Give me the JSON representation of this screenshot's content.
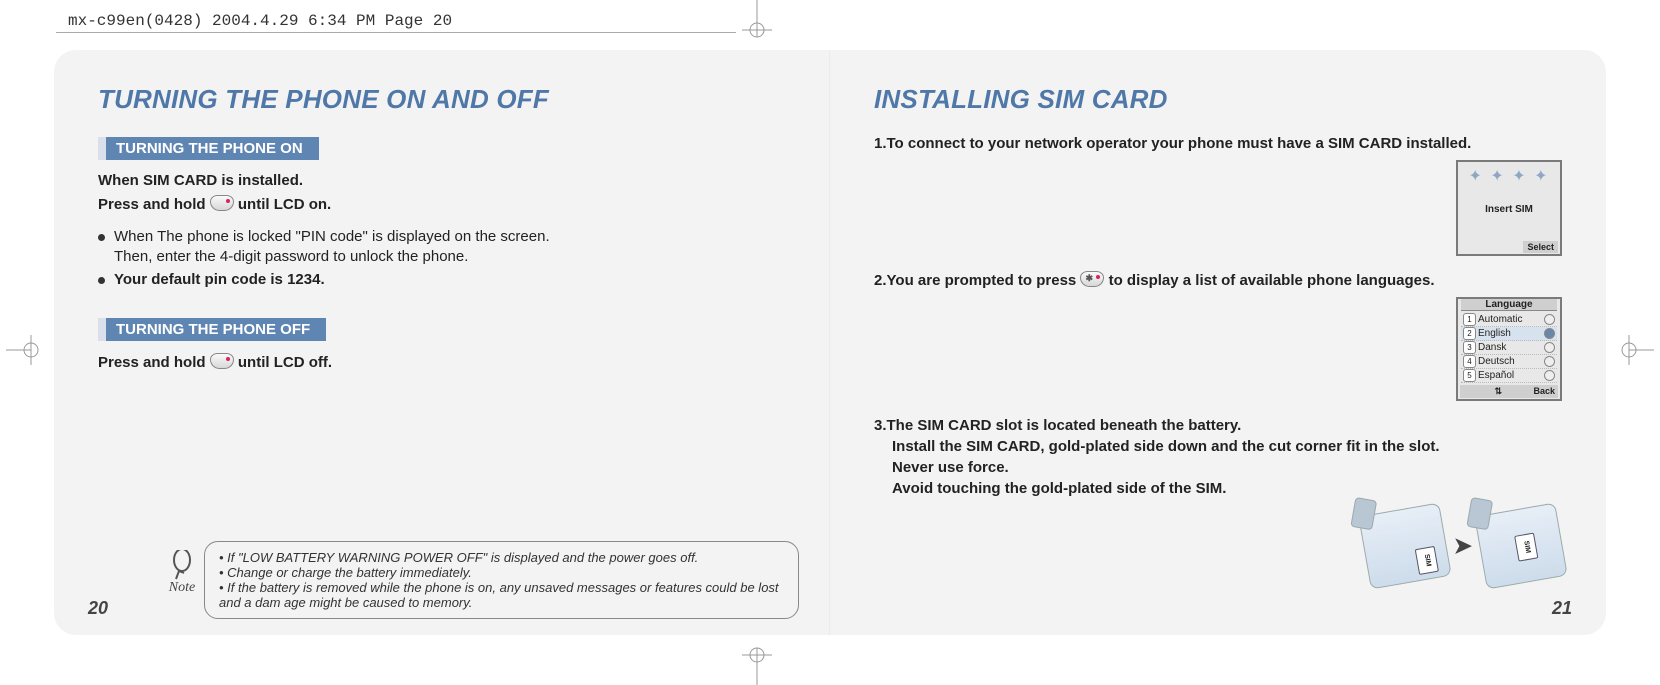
{
  "header_line": "mx-c99en(0428)  2004.4.29  6:34 PM  Page 20",
  "left": {
    "title": "TURNING THE PHONE ON AND OFF",
    "section_on": "TURNING THE PHONE ON",
    "on_line1": "When SIM CARD is installed.",
    "on_line2a": "Press and hold ",
    "on_line2b": " until LCD on.",
    "bullet1a": "When The phone is locked \"PIN code\" is displayed on the screen.",
    "bullet1b": "Then, enter the 4-digit password to unlock the phone.",
    "bullet2": "Your default pin code is 1234.",
    "section_off": "TURNING THE PHONE OFF",
    "off_line1a": "Press and hold ",
    "off_line1b": " until LCD off.",
    "note_label": "Note",
    "note1": "If \"LOW BATTERY WARNING POWER OFF\" is displayed and the power goes off.",
    "note2": "Change or charge the battery immediately.",
    "note3": "If the battery is removed while the phone is on, any unsaved messages or features could be lost and a dam age might be caused to memory.",
    "page_num": "20"
  },
  "right": {
    "title": "INSTALLING SIM CARD",
    "step1": "1.To connect to your network operator your phone must have a SIM CARD installed.",
    "screen1_msg": "Insert SIM",
    "screen1_soft": "Select",
    "step2a": "2.You are prompted to press ",
    "step2b": " to display a list of available phone languages.",
    "screen2_title": "Language",
    "screen2_items": [
      "Automatic",
      "English",
      "Dansk",
      "Deutsch",
      "Español"
    ],
    "screen2_selected_index": 1,
    "screen2_soft_left": "",
    "screen2_soft_right": "Back",
    "step3a": "3.The SIM CARD slot is located beneath the battery.",
    "step3b": "Install the SIM CARD, gold-plated side down and the cut corner fit in the slot.",
    "step3c": "Never use force.",
    "step3d": "Avoid touching the gold-plated side of the SIM.",
    "sim_label": "SIM",
    "arrow": "➤",
    "page_num": "21"
  }
}
